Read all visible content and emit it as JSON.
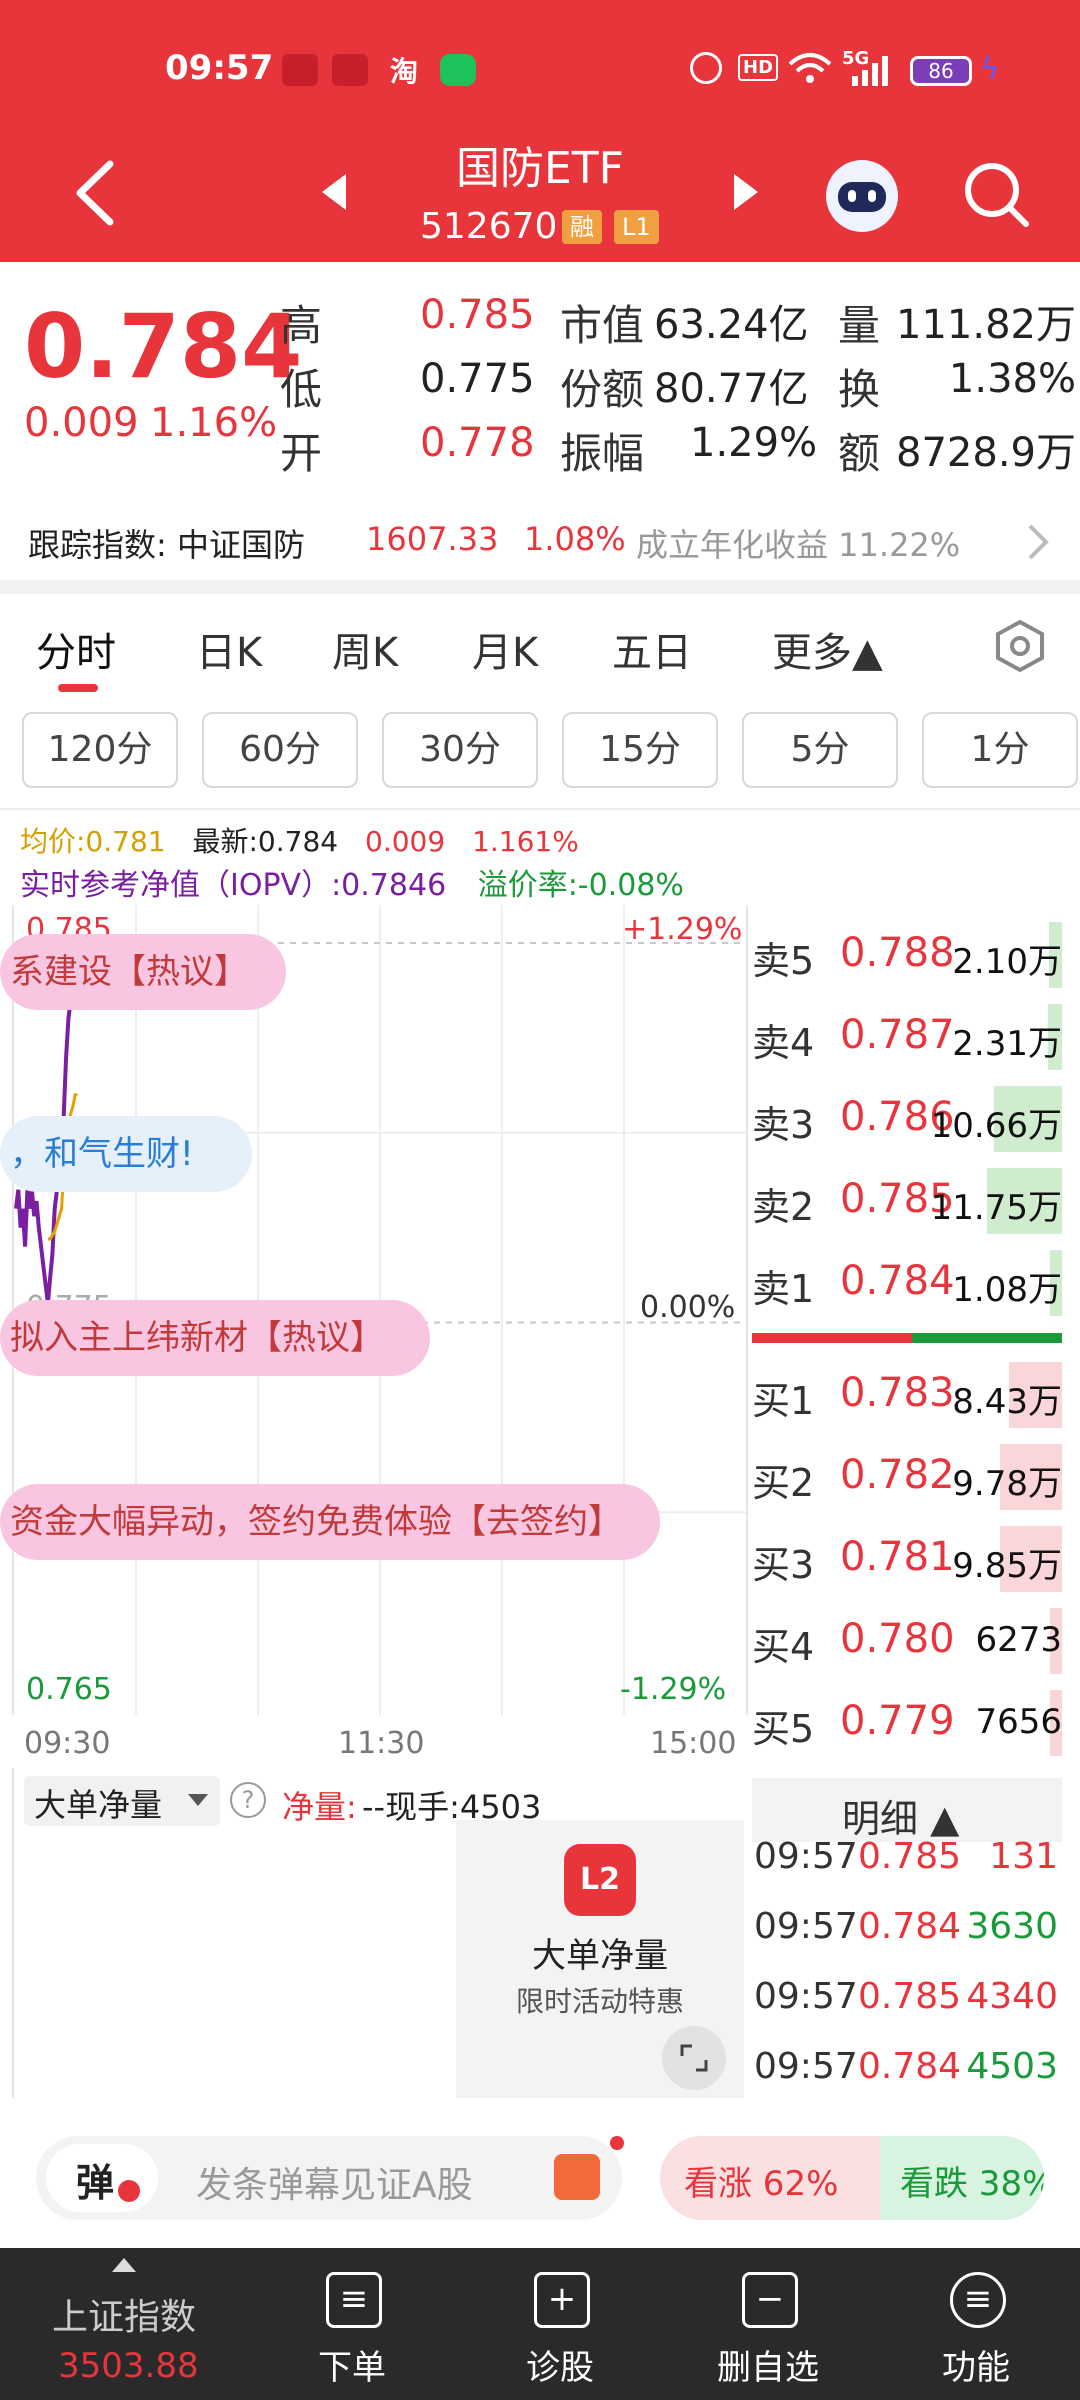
{
  "status_bar": {
    "time": "09:57",
    "network": "5G",
    "battery": "86",
    "icons": [
      "app-icon-1",
      "app-icon-2",
      "taobao-icon",
      "wechat-icon",
      "alarm-icon",
      "hd-icon",
      "wifi-icon",
      "signal-icon",
      "charging-icon"
    ],
    "taobao": "淘"
  },
  "nav": {
    "title": "国防ETF",
    "code": "512670",
    "tag_rong": "融",
    "tag_level": "L1"
  },
  "quote": {
    "price": "0.784",
    "change": "0.009",
    "change_pct": "1.16%",
    "labels": {
      "high": "高",
      "low": "低",
      "open": "开",
      "mkt_cap": "市值",
      "shares": "份额",
      "amplitude": "振幅",
      "volume": "量",
      "turnover": "换",
      "amount": "额"
    },
    "high": "0.785",
    "low": "0.775",
    "open": "0.778",
    "mkt_cap": "63.24亿",
    "shares": "80.77亿",
    "amplitude": "1.29%",
    "volume": "111.82万",
    "turnover": "1.38%",
    "amount": "8728.9万"
  },
  "tracking": {
    "label": "跟踪指数: 中证国防",
    "index_value": "1607.33",
    "index_pct": "1.08%",
    "annual_label": "成立年化收益 11.22%"
  },
  "tabs": [
    "分时",
    "日K",
    "周K",
    "月K",
    "五日",
    "更多▲"
  ],
  "periods": [
    "120分",
    "60分",
    "30分",
    "15分",
    "5分",
    "1分"
  ],
  "chart_info": {
    "avg_price": "均价:0.781",
    "latest": "最新:0.784",
    "latest_chg": "0.009",
    "latest_pct": "1.161%",
    "iopv": "实时参考净值（IOPV）:0.7846",
    "premium": "溢价率:-0.08%",
    "top_price": "0.785",
    "top_pct": "+1.29%",
    "mid_price": "0.775",
    "mid_pct": "0.00%",
    "bottom_price": "0.765",
    "bottom_pct": "-1.29%",
    "times": [
      "09:30",
      "11:30",
      "15:00"
    ]
  },
  "chart_data": {
    "type": "line",
    "ylim": [
      0.765,
      0.785
    ],
    "x": [
      "09:30",
      "09:31",
      "09:32",
      "09:33",
      "09:34",
      "09:35",
      "09:36",
      "09:37",
      "09:38",
      "09:39",
      "09:40",
      "09:41",
      "09:42",
      "09:43",
      "09:44",
      "09:45",
      "09:46",
      "09:47",
      "09:48",
      "09:49",
      "09:50",
      "09:51",
      "09:52",
      "09:53",
      "09:54",
      "09:55",
      "09:56",
      "09:57"
    ],
    "series": [
      {
        "name": "最新",
        "values": [
          0.778,
          0.7785,
          0.7775,
          0.778,
          0.777,
          0.7785,
          0.778,
          0.7785,
          0.7778,
          0.7782,
          0.7775,
          0.777,
          0.7765,
          0.776,
          0.7755,
          0.7762,
          0.7768,
          0.778,
          0.7785,
          0.779,
          0.7795,
          0.7805,
          0.782,
          0.783,
          0.7835,
          0.784,
          0.785,
          0.784
        ]
      },
      {
        "name": "均价",
        "values": [
          null,
          null,
          null,
          null,
          null,
          null,
          null,
          null,
          null,
          null,
          null,
          null,
          null,
          null,
          0.7772,
          0.7772,
          0.7773,
          0.7774,
          0.7776,
          0.7778,
          0.778,
          0.779,
          0.7798,
          0.7803,
          0.7805,
          0.7807,
          0.781,
          0.781
        ]
      }
    ]
  },
  "order_book": {
    "sell": [
      {
        "label": "卖5",
        "price": "0.788",
        "vol": "2.10万",
        "ratio": 0.1
      },
      {
        "label": "卖4",
        "price": "0.787",
        "vol": "2.31万",
        "ratio": 0.11
      },
      {
        "label": "卖3",
        "price": "0.786",
        "vol": "10.66万",
        "ratio": 0.52
      },
      {
        "label": "卖2",
        "price": "0.785",
        "vol": "11.75万",
        "ratio": 0.58
      },
      {
        "label": "卖1",
        "price": "0.784",
        "vol": "1.08万",
        "ratio": 0.06
      }
    ],
    "buy": [
      {
        "label": "买1",
        "price": "0.783",
        "vol": "8.43万",
        "ratio": 0.41
      },
      {
        "label": "买2",
        "price": "0.782",
        "vol": "9.78万",
        "ratio": 0.48
      },
      {
        "label": "买3",
        "price": "0.781",
        "vol": "9.85万",
        "ratio": 0.48
      },
      {
        "label": "买4",
        "price": "0.780",
        "vol": "6273",
        "ratio": 0.03
      },
      {
        "label": "买5",
        "price": "0.779",
        "vol": "7656",
        "ratio": 0.04
      }
    ]
  },
  "danmaku": [
    "系建设【热议】",
    "，和气生财!",
    "拟入主上纬新材【热议】",
    "资金大幅异动，签约免费体验【去签约】"
  ],
  "big_order": {
    "selector": "大单净量",
    "net_label": "净量:",
    "net_value": "--现手:4503",
    "promo_title": "大单净量",
    "promo_sub": "限时活动特惠",
    "promo_badge": "L2"
  },
  "details": {
    "header": "明细 ▲",
    "rows": [
      {
        "time": "09:57",
        "price": "0.785",
        "vol": "131"
      },
      {
        "time": "09:57",
        "price": "0.784",
        "vol": "3630",
        "color": "green"
      },
      {
        "time": "09:57",
        "price": "0.785",
        "vol": "4340",
        "color": "red"
      },
      {
        "time": "09:57",
        "price": "0.784",
        "vol": "4503",
        "color": "green"
      }
    ]
  },
  "comment_bar": {
    "danmu_icon": "弹",
    "placeholder": "发条弹幕见证A股",
    "bull": "看涨 62%",
    "bear": "看跌 38%",
    "bull_ratio": 0.62
  },
  "bottom_nav": {
    "index_name": "上证指数",
    "index_value": "3503.88",
    "items": [
      "下单",
      "诊股",
      "删自选",
      "功能"
    ]
  }
}
